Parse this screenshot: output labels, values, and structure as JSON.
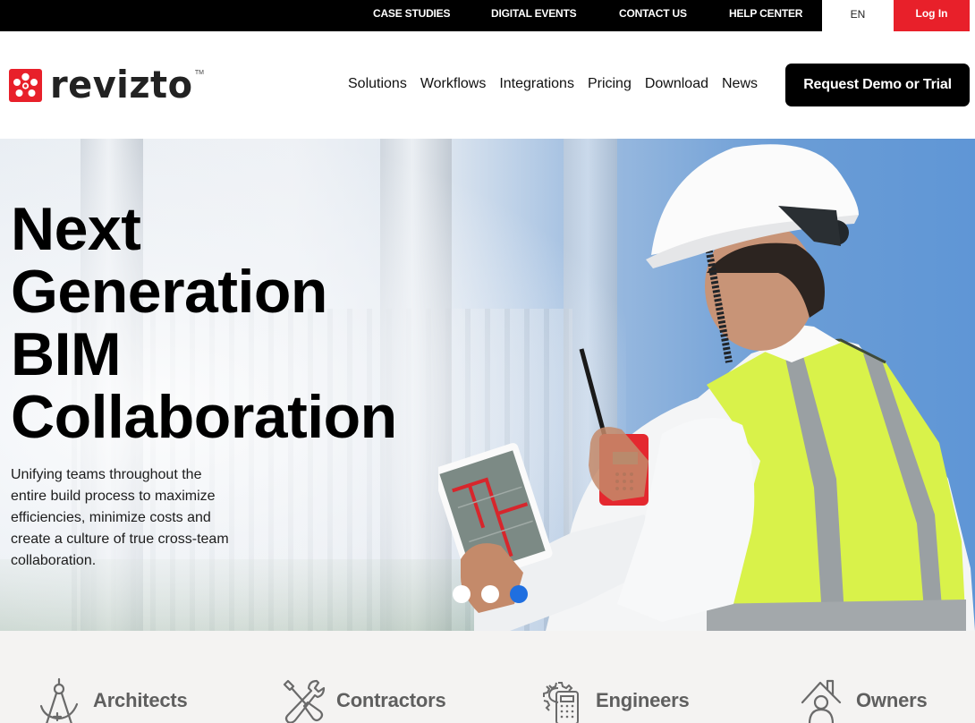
{
  "topbar": {
    "links": [
      {
        "label": "CASE STUDIES"
      },
      {
        "label": "DIGITAL EVENTS"
      },
      {
        "label": "CONTACT US"
      },
      {
        "label": "HELP CENTER"
      }
    ],
    "language": "EN",
    "login_label": "Log In"
  },
  "header": {
    "logo_text": "revizto",
    "logo_tm": "TM",
    "nav": [
      {
        "label": "Solutions"
      },
      {
        "label": "Workflows"
      },
      {
        "label": "Integrations"
      },
      {
        "label": "Pricing"
      },
      {
        "label": "Download"
      },
      {
        "label": "News"
      }
    ],
    "cta_label": "Request Demo or Trial"
  },
  "hero": {
    "title_lines": [
      "Next",
      "Generation",
      "BIM",
      "Collaboration"
    ],
    "subtitle": "Unifying teams throughout the entire build process to maximize efficiencies, minimize costs and create a culture of true cross-team collaboration.",
    "image_alt": "engineer-in-hard-hat-with-tablet-and-radio",
    "carousel": {
      "total": 3,
      "active_index": 3
    }
  },
  "roles": [
    {
      "label": "Architects",
      "icon": "compass-icon"
    },
    {
      "label": "Contractors",
      "icon": "tools-icon"
    },
    {
      "label": "Engineers",
      "icon": "calculator-gear-icon"
    },
    {
      "label": "Owners",
      "icon": "house-person-icon"
    }
  ],
  "colors": {
    "brand_red": "#e8202a",
    "carousel_active": "#1f6fe0",
    "role_text": "#5f5f5f"
  }
}
